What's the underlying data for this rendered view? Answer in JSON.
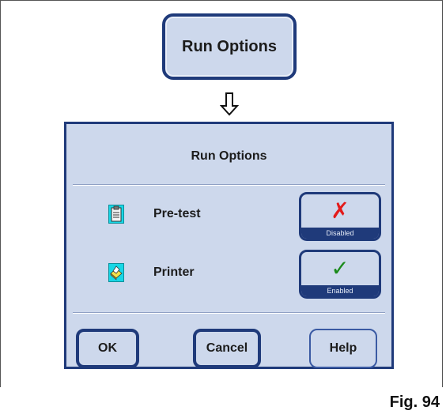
{
  "top_button": {
    "label": "Run Options"
  },
  "arrow_icon": "down-arrow-icon",
  "dialog": {
    "title": "Run Options",
    "options": [
      {
        "label": "Pre-test",
        "icon": "clipboard-icon",
        "state_mark": "✗",
        "state_mark_color": "#e31b1b",
        "state": "Disabled"
      },
      {
        "label": "Printer",
        "icon": "printer-icon",
        "state_mark": "✓",
        "state_mark_color": "#1a8a1a",
        "state": "Enabled"
      }
    ],
    "buttons": {
      "ok": "OK",
      "cancel": "Cancel",
      "help": "Help"
    }
  },
  "figure_label": "Fig. 94",
  "colors": {
    "accent": "#1f3a7a",
    "panel": "#cdd8ec",
    "icon_bg": "#17d7e6"
  }
}
